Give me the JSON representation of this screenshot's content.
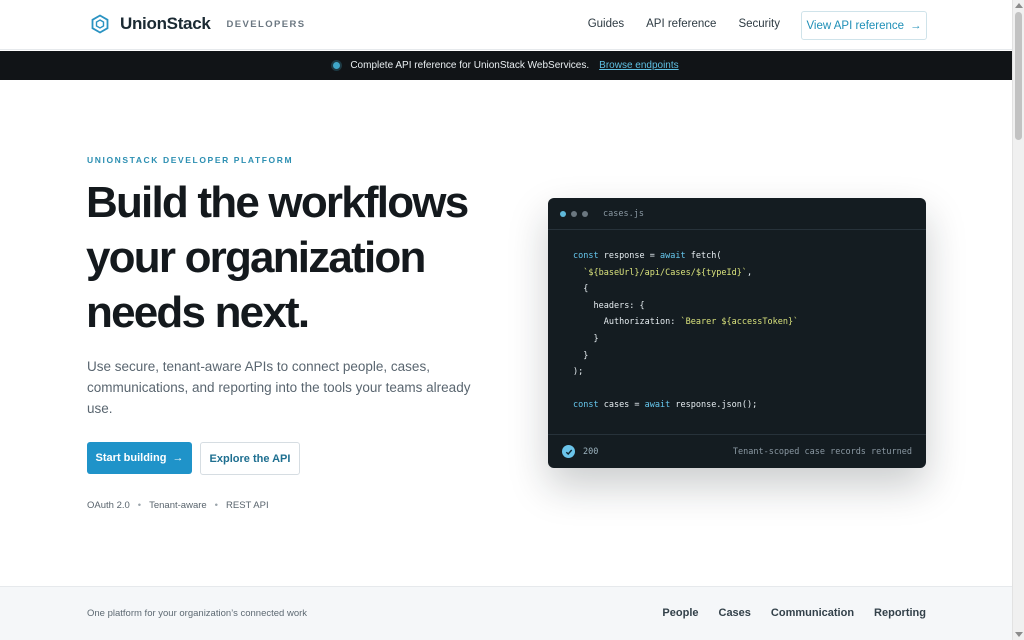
{
  "header": {
    "brand": "UnionStack",
    "brand_sub": "DEVELOPERS",
    "nav": [
      {
        "label": "Guides"
      },
      {
        "label": "API reference"
      },
      {
        "label": "Security"
      }
    ],
    "cta_label": "View API reference",
    "cta_arrow": "→"
  },
  "banner": {
    "text": "Complete API reference for UnionStack WebServices.",
    "link": "Browse endpoints"
  },
  "hero": {
    "eyebrow": "UNIONSTACK DEVELOPER PLATFORM",
    "title": "Build the workflows your organization needs next.",
    "description": "Use secure, tenant-aware APIs to connect people, cases, communications, and reporting into the tools your teams already use.",
    "primary_label": "Start building",
    "primary_arrow": "→",
    "secondary_label": "Explore the API",
    "tags": [
      "OAuth 2.0",
      "Tenant-aware",
      "REST API"
    ],
    "tag_separator": "•"
  },
  "code": {
    "file_name": "cases.js",
    "dots": [
      "#5fb8d9",
      "#6b7780",
      "#6b7780"
    ],
    "l1_kw": "const",
    "l1_a": " response = ",
    "l1_kw2": "await",
    "l1_b": " fetch(",
    "l2": "`${baseUrl}/api/Cases/${typeId}`",
    "l2_end": ",",
    "l3": "{",
    "l4": "headers: {",
    "l5_a": "Authorization: ",
    "l5_b": "`Bearer ${accessToken}`",
    "l6": "}",
    "l7": "}",
    "l8": ");",
    "l9_kw": "const",
    "l9_a": " cases = ",
    "l9_kw2": "await",
    "l9_b": " response.json();",
    "status_code": "200",
    "status_message": "Tenant-scoped case records returned"
  },
  "footer": {
    "text": "One platform for your organization’s connected work",
    "nav": [
      {
        "label": "People"
      },
      {
        "label": "Cases"
      },
      {
        "label": "Communication"
      },
      {
        "label": "Reporting"
      }
    ]
  },
  "colors": {
    "accent": "#1f93c9",
    "banner_bg": "#111417",
    "code_bg": "#141c21",
    "heading": "#14191d"
  }
}
